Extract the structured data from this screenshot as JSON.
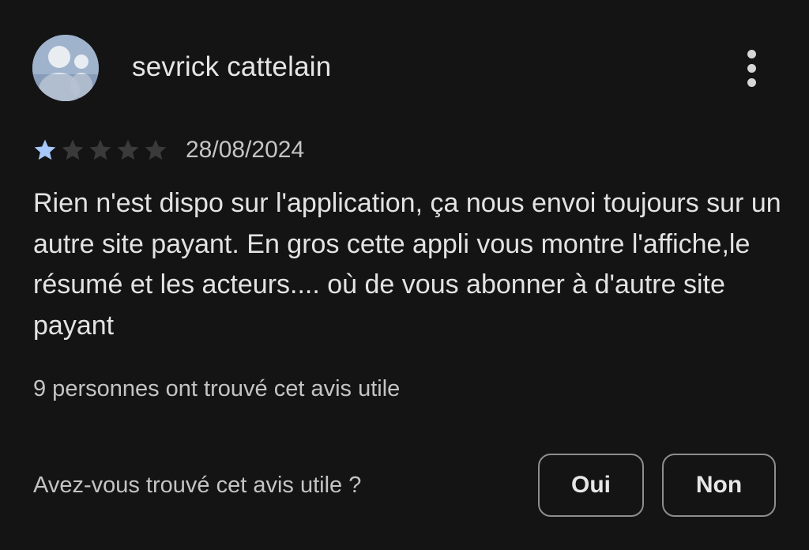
{
  "review": {
    "author": "sevrick cattelain",
    "avatar_icon": "user-avatar",
    "menu_icon": "more-vertical-icon",
    "rating": 1,
    "max_rating": 5,
    "date": "28/08/2024",
    "text": "Rien n'est dispo sur l'application, ça nous envoi toujours sur un autre site payant. En gros cette appli vous montre l'affiche,le résumé et les acteurs.... où de vous abonner à d'autre site payant",
    "helpful_count_text": "9 personnes ont trouvé cet avis utile"
  },
  "feedback": {
    "question": "Avez-vous trouvé cet avis utile ?",
    "yes_label": "Oui",
    "no_label": "Non"
  },
  "colors": {
    "background": "#141414",
    "star_filled": "#a8c7fa",
    "star_empty": "#3a3a3a",
    "text_primary": "#e3e3e3",
    "text_secondary": "#c4c4c4",
    "button_border": "#8e8e8e"
  }
}
